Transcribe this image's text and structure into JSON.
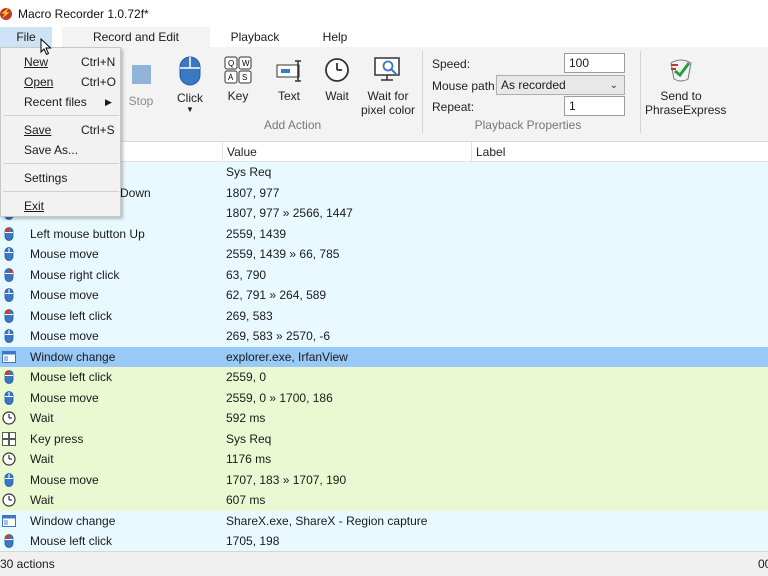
{
  "window": {
    "title": "Macro Recorder 1.0.72f*"
  },
  "menubar": {
    "file": "File",
    "record_edit": "Record and Edit",
    "playback": "Playback",
    "help": "Help"
  },
  "ribbon": {
    "stop": "Stop",
    "click": "Click",
    "key": "Key",
    "text": "Text",
    "wait": "Wait",
    "wait_pixel_1": "Wait for",
    "wait_pixel_2": "pixel color",
    "add_action_group": "Add Action",
    "speed_label": "Speed:",
    "speed_value": "100",
    "mouse_path_label": "Mouse path:",
    "mouse_path_value": "As recorded",
    "repeat_label": "Repeat:",
    "repeat_value": "1",
    "playback_group": "Playback Properties",
    "send_1": "Send to",
    "send_2": "PhraseExpress"
  },
  "file_menu": {
    "new": "New",
    "new_shortcut": "Ctrl+N",
    "open": "Open",
    "open_shortcut": "Ctrl+O",
    "recent": "Recent files",
    "save": "Save",
    "save_shortcut": "Ctrl+S",
    "save_as": "Save As...",
    "settings": "Settings",
    "exit": "Exit"
  },
  "grid": {
    "columns": {
      "value": "Value",
      "label": "Label"
    },
    "rows": [
      {
        "icon": "key-icon",
        "action": "",
        "value": "Sys Req",
        "tone": "cyan"
      },
      {
        "icon": "mouse-left-icon",
        "action": "Down",
        "value": "1807, 977",
        "tone": "cyan"
      },
      {
        "icon": "mouse-icon",
        "action": "",
        "value": "1807, 977 » 2566, 1447",
        "tone": "cyan"
      },
      {
        "icon": "mouse-left-icon",
        "action": "Left mouse button Up",
        "value": "2559, 1439",
        "tone": "cyan"
      },
      {
        "icon": "mouse-icon",
        "action": "Mouse move",
        "value": "2559, 1439 » 66, 785",
        "tone": "cyan"
      },
      {
        "icon": "mouse-right-icon",
        "action": "Mouse right click",
        "value": "63, 790",
        "tone": "cyan"
      },
      {
        "icon": "mouse-icon",
        "action": "Mouse move",
        "value": "62, 791 » 264, 589",
        "tone": "cyan"
      },
      {
        "icon": "mouse-left-icon",
        "action": "Mouse left click",
        "value": "269, 583",
        "tone": "cyan"
      },
      {
        "icon": "mouse-icon",
        "action": "Mouse move",
        "value": "269, 583 » 2570, -6",
        "tone": "cyan"
      },
      {
        "icon": "window-icon",
        "action": "Window change",
        "value": "explorer.exe, IrfanView",
        "tone": "selected"
      },
      {
        "icon": "mouse-left-icon",
        "action": "Mouse left click",
        "value": "2559, 0",
        "tone": "green"
      },
      {
        "icon": "mouse-icon",
        "action": "Mouse move",
        "value": "2559, 0 » 1700, 186",
        "tone": "green"
      },
      {
        "icon": "clock-icon",
        "action": "Wait",
        "value": "592 ms",
        "tone": "green"
      },
      {
        "icon": "key-icon",
        "action": "Key press",
        "value": "Sys Req",
        "tone": "green"
      },
      {
        "icon": "clock-icon",
        "action": "Wait",
        "value": "1176 ms",
        "tone": "green"
      },
      {
        "icon": "mouse-icon",
        "action": "Mouse move",
        "value": "1707, 183 » 1707, 190",
        "tone": "green"
      },
      {
        "icon": "clock-icon",
        "action": "Wait",
        "value": "607 ms",
        "tone": "green"
      },
      {
        "icon": "window-icon",
        "action": "Window change",
        "value": "ShareX.exe, ShareX - Region capture",
        "tone": "cyan"
      },
      {
        "icon": "mouse-left-icon",
        "action": "Mouse left click",
        "value": "1705, 198",
        "tone": "cyan"
      }
    ]
  },
  "status": {
    "left": "30 actions",
    "right": "00"
  }
}
